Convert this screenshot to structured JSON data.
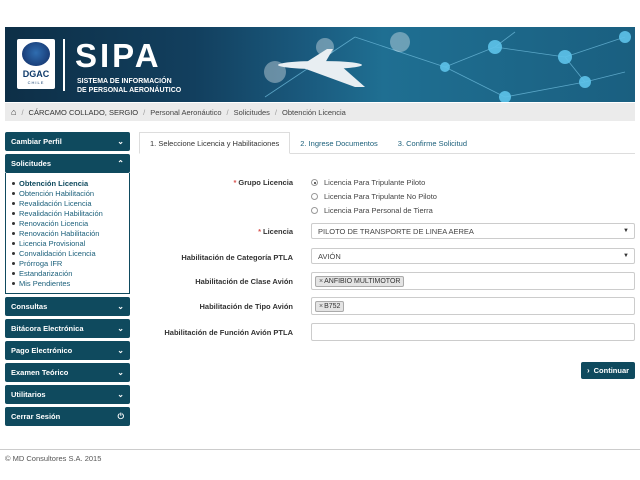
{
  "banner": {
    "logo_text": "DGAC",
    "logo_sub": "CHILE",
    "title": "SIPA",
    "subtitle_line1": "SISTEMA DE INFORMACIÓN",
    "subtitle_line2": "DE PERSONAL AERONÁUTICO"
  },
  "breadcrumb": {
    "home_icon": "home-icon",
    "items": [
      "CÁRCAMO COLLADO, SERGIO",
      "Personal Aeronáutico",
      "Solicitudes",
      "Obtención Licencia"
    ]
  },
  "sidebar": {
    "cambiar_perfil": "Cambiar Perfil",
    "solicitudes": "Solicitudes",
    "solicitudes_items": [
      "Obtención Licencia",
      "Obtención Habilitación",
      "Revalidación Licencia",
      "Revalidación Habilitación",
      "Renovación Licencia",
      "Renovación Habilitación",
      "Licencia Provisional",
      "Convalidación Licencia",
      "Prórroga IFR",
      "Estandarización",
      "Mis Pendientes"
    ],
    "consultas": "Consultas",
    "bitacora": "Bitácora Electrónica",
    "pago": "Pago Electrónico",
    "examen": "Examen Teórico",
    "utilitarios": "Utilitarios",
    "cerrar": "Cerrar Sesión"
  },
  "tabs": [
    "1. Seleccione Licencia y Habilitaciones",
    "2. Ingrese Documentos",
    "3. Confirme Solicitud"
  ],
  "form": {
    "grupo_label": "Grupo Licencia",
    "grupo_options": [
      "Licencia Para Tripulante Piloto",
      "Licencia Para Tripulante No Piloto",
      "Licencia Para Personal de Tierra"
    ],
    "licencia_label": "Licencia",
    "licencia_value": "PILOTO DE TRANSPORTE DE LINEA AEREA",
    "categoria_label": "Habilitación de Categoría PTLA",
    "categoria_value": "AVIÓN",
    "clase_label": "Habilitación de Clase Avión",
    "clase_tag": "ANFIBIO MULTIMOTOR",
    "tipo_label": "Habilitación de Tipo Avión",
    "tipo_tag": "B752",
    "funcion_label": "Habilitación de Función Avión PTLA",
    "funcion_value": "",
    "continue_label": "Continuar"
  },
  "footer": "© MD Consultores S.A. 2015"
}
